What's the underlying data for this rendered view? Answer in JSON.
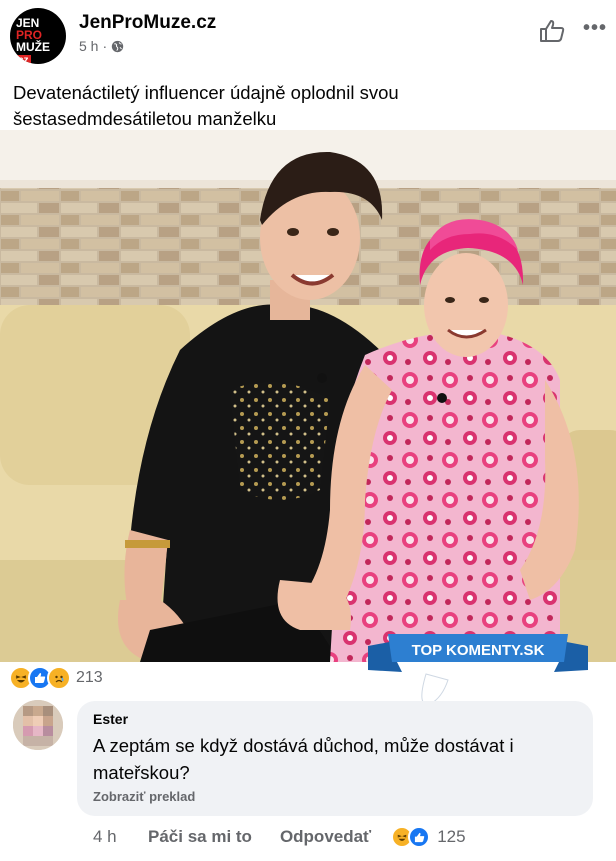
{
  "post": {
    "page_name": "JenProMuze.cz",
    "time": "5 h",
    "separator": "·",
    "text_line1": "Devatenáctiletý influencer údajně oplodnil svou",
    "text_line2": "šestasedmdesátiletou manželku",
    "avatar_logo": [
      "JEN",
      "PRO",
      "MUŽE",
      "cz"
    ]
  },
  "reactions": {
    "icons": [
      "haha-icon",
      "like-icon",
      "sad-icon"
    ],
    "count": "213"
  },
  "badge": {
    "text": "TOP KOMENTY.SK"
  },
  "comment": {
    "author": "Ester",
    "text_line1": "A zeptám se když dostává důchod, může dostávat i",
    "text_line2": "mateřskou?",
    "translate": "Zobraziť preklad",
    "time": "4 h",
    "like": "Páči sa mi to",
    "reply": "Odpovedať",
    "reaction_icons": [
      "haha-icon",
      "like-icon"
    ],
    "reaction_count": "125"
  },
  "colors": {
    "accent_blue": "#1877f2",
    "muted": "#65676b",
    "bubble": "#f0f2f5",
    "pink_hair": "#e8267a"
  }
}
